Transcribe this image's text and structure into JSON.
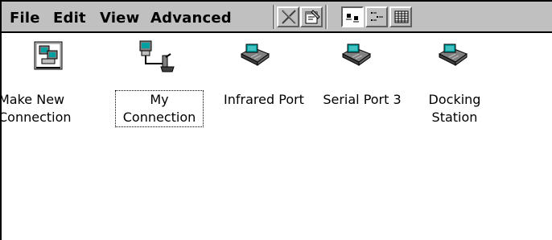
{
  "menu": {
    "file": "File",
    "edit": "Edit",
    "view": "View",
    "advanced": "Advanced"
  },
  "toolbar": {
    "buttons": [
      {
        "icon": "delete-x-icon",
        "pressed": false
      },
      {
        "icon": "properties-icon",
        "pressed": false
      },
      {
        "icon": "large-icons-view-icon",
        "pressed": true
      },
      {
        "icon": "small-icons-view-icon",
        "pressed": false
      },
      {
        "icon": "details-view-icon",
        "pressed": false
      }
    ]
  },
  "items": [
    {
      "line1": "Make New",
      "line2": "Connection",
      "icon": "make-new-connection-icon"
    },
    {
      "line1": "My",
      "line2": "Connection",
      "icon": "connection-computer-icon",
      "focused": true
    },
    {
      "line1": "Infrared Port",
      "line2": "",
      "icon": "port-device-icon"
    },
    {
      "line1": "Serial Port 3",
      "line2": "",
      "icon": "port-device-icon"
    },
    {
      "line1": "Docking",
      "line2": "Station",
      "icon": "port-device-icon"
    }
  ]
}
